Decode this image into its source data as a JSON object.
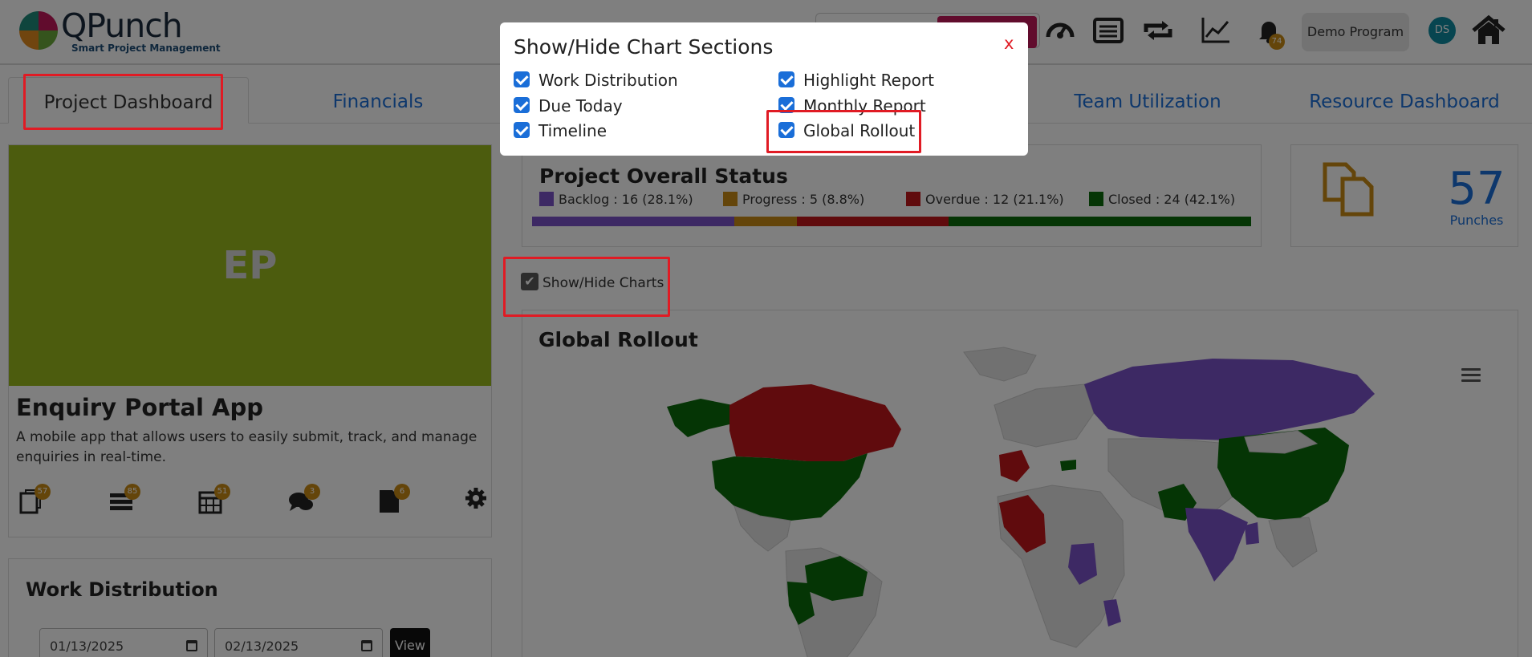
{
  "header": {
    "app_name": "QPunch",
    "tagline": "Smart Project Management",
    "notifications_count": "74",
    "program_label": "Demo Program",
    "user_initials": "DS",
    "icons": [
      "dashboard-gauge-icon",
      "list-icon",
      "sync-icon",
      "line-chart-icon",
      "bell-icon",
      "home-icon"
    ]
  },
  "tabs": [
    "Project Dashboard",
    "Financials",
    "Team Utilization",
    "Resource Dashboard"
  ],
  "project": {
    "initials": "EP",
    "banner_color": "#98b81c",
    "title": "Enquiry Portal App",
    "description": "A mobile app that allows users to easily submit, track, and manage enquiries in real-time.",
    "icon_badges": [
      {
        "icon": "punch-icon",
        "count": "57"
      },
      {
        "icon": "tasks-icon",
        "count": "85"
      },
      {
        "icon": "calendar-icon",
        "count": "51"
      },
      {
        "icon": "comments-icon",
        "count": "3"
      },
      {
        "icon": "document-icon",
        "count": "6"
      }
    ]
  },
  "work_distribution": {
    "title": "Work Distribution",
    "start_date": "01/13/2025",
    "end_date": "02/13/2025",
    "view_label": "View"
  },
  "overall_status": {
    "title": "Project Overall Status",
    "items": [
      {
        "label": "Backlog : 16 (28.1%)",
        "value": 16,
        "pct": 28.1,
        "color": "#7b52c9"
      },
      {
        "label": "Progress : 5 (8.8%)",
        "value": 5,
        "pct": 8.8,
        "color": "#c98a14"
      },
      {
        "label": "Overdue : 12 (21.1%)",
        "value": 12,
        "pct": 21.1,
        "color": "#c0171b"
      },
      {
        "label": "Closed : 24 (42.1%)",
        "value": 24,
        "pct": 42.1,
        "color": "#0b6b0b"
      }
    ]
  },
  "punches": {
    "count": "57",
    "label": "Punches"
  },
  "show_hide_charts": {
    "label": "Show/Hide Charts",
    "checked": true
  },
  "global_rollout": {
    "title": "Global Rollout"
  },
  "modal": {
    "title": "Show/Hide Chart Sections",
    "close_label": "x",
    "options_left": [
      "Work Distribution",
      "Due Today",
      "Timeline"
    ],
    "options_right": [
      "Highlight Report",
      "Monthly Report",
      "Global Rollout"
    ]
  },
  "colors": {
    "accent": "#1a6ed8",
    "badge": "#c98a14",
    "highlight": "#e01b24"
  }
}
